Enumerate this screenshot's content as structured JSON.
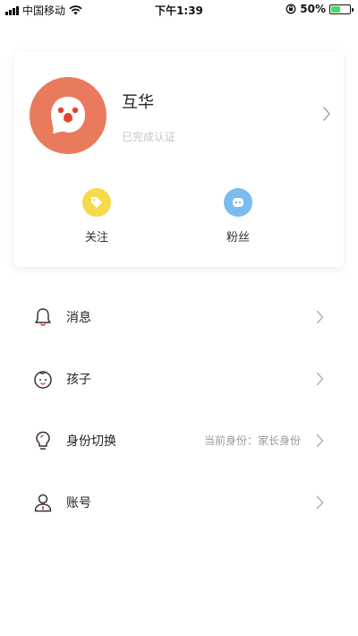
{
  "status_bar": {
    "carrier": "中国移动",
    "time": "下午1:39",
    "battery_percent": "50%",
    "battery_level": 0.5,
    "icons": [
      "signal-icon",
      "wifi-icon",
      "orientation-lock-icon",
      "battery-icon"
    ]
  },
  "profile": {
    "name": "互华",
    "certification_status": "已完成认证",
    "avatar_icon": "ghost-face-icon",
    "avatar_color": "#e97a5e",
    "stats": [
      {
        "label": "关注",
        "icon": "tag-icon",
        "color": "#f7d94c"
      },
      {
        "label": "粉丝",
        "icon": "robot-face-icon",
        "color": "#7bbcf0"
      }
    ]
  },
  "menu": {
    "items": [
      {
        "label": "消息",
        "icon": "bell-icon",
        "value": ""
      },
      {
        "label": "孩子",
        "icon": "child-face-icon",
        "value": ""
      },
      {
        "label": "身份切换",
        "icon": "lightbulb-icon",
        "value": "当前身份：家长身份"
      },
      {
        "label": "账号",
        "icon": "user-icon",
        "value": ""
      }
    ]
  },
  "colors": {
    "accent_orange": "#e97a5e",
    "accent_red": "#e0452c",
    "muted_text": "#999999"
  }
}
